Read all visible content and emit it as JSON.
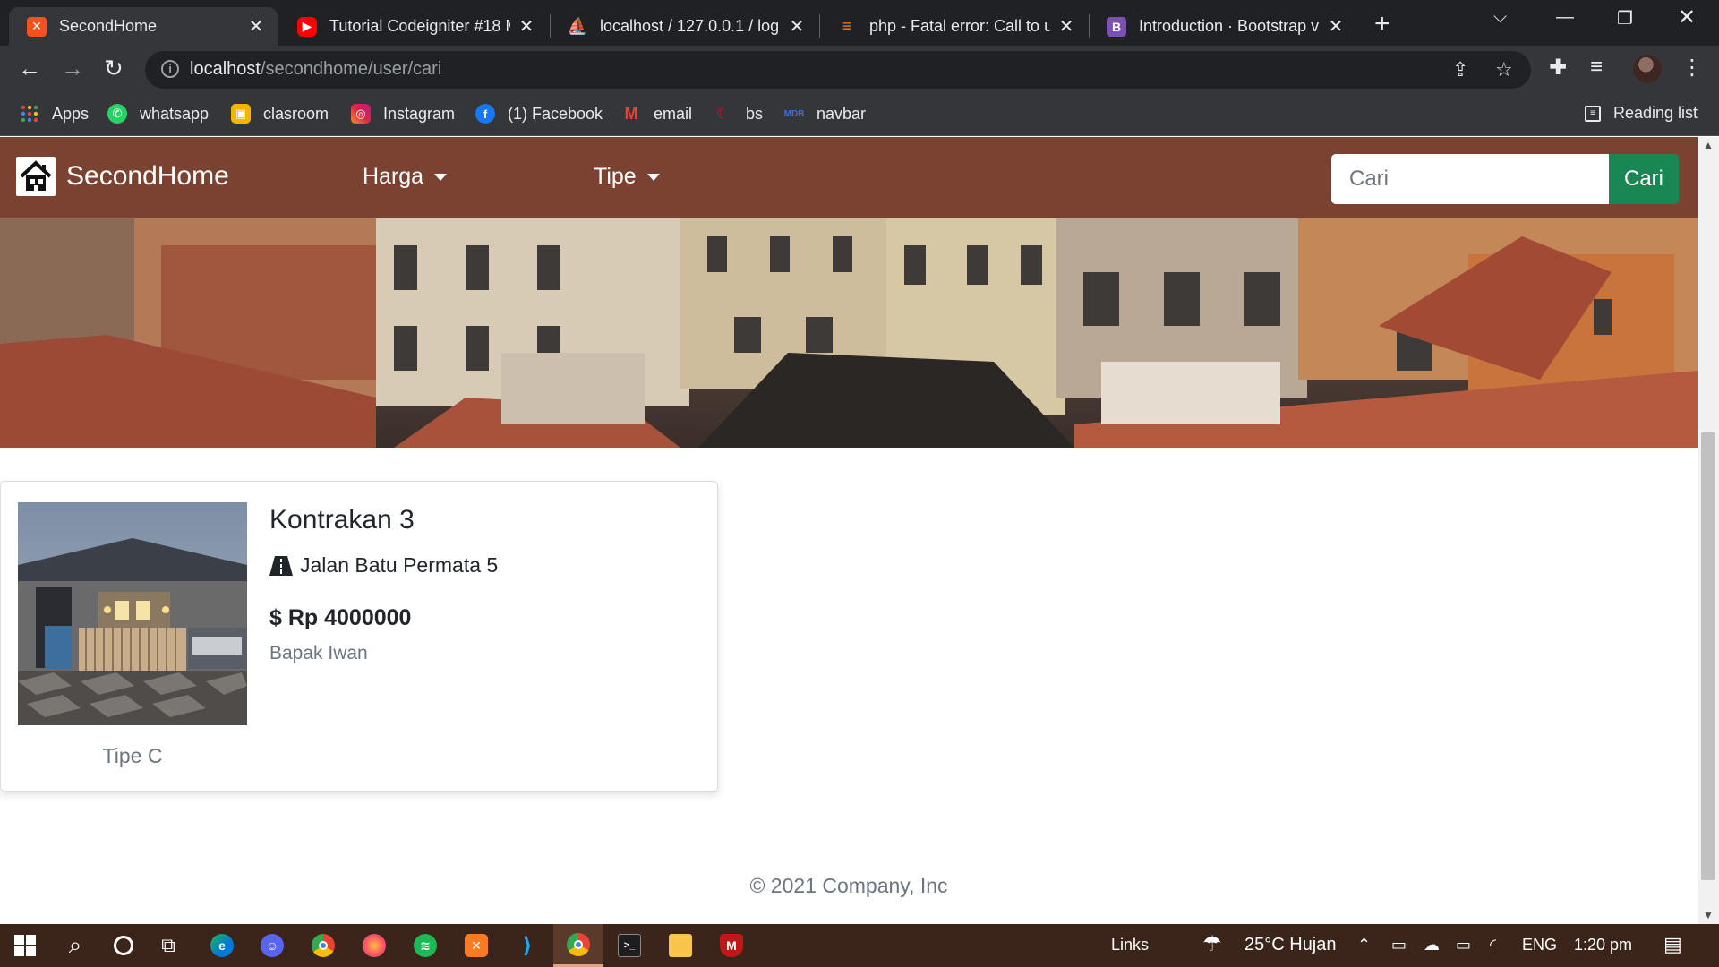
{
  "browser": {
    "tabs": [
      {
        "title": "SecondHome",
        "active": true
      },
      {
        "title": "Tutorial Codeigniter #18 M",
        "active": false
      },
      {
        "title": "localhost / 127.0.0.1 / log",
        "active": false
      },
      {
        "title": "php - Fatal error: Call to u",
        "active": false
      },
      {
        "title": "Introduction · Bootstrap v",
        "active": false
      }
    ],
    "url_host": "localhost",
    "url_path": "/secondhome/user/cari",
    "bookmarks": [
      {
        "label": "Apps",
        "icon": "apps-grid-icon",
        "color": "#ea4335"
      },
      {
        "label": "whatsapp",
        "icon": "whatsapp-icon",
        "color": "#25d366"
      },
      {
        "label": "clasroom",
        "icon": "classroom-icon",
        "color": "#f4b400"
      },
      {
        "label": "Instagram",
        "icon": "instagram-icon",
        "color": "#c13584"
      },
      {
        "label": "(1) Facebook",
        "icon": "facebook-icon",
        "color": "#1877f2"
      },
      {
        "label": "email",
        "icon": "gmail-icon",
        "color": "#ea4335"
      },
      {
        "label": "bs",
        "icon": "bs-icon",
        "color": "#b71c1c"
      },
      {
        "label": "navbar",
        "icon": "mdb-icon",
        "color": "#3b71ca"
      }
    ],
    "reading_list": "Reading list"
  },
  "site": {
    "brand": "SecondHome",
    "nav": {
      "harga": "Harga",
      "tipe": "Tipe"
    },
    "search": {
      "placeholder": "Cari",
      "button": "Cari"
    },
    "colors": {
      "navbar": "#7b4231",
      "search_button": "#198754"
    }
  },
  "listing": {
    "title": "Kontrakan 3",
    "address": "Jalan Batu Permata 5",
    "price": "$ Rp 4000000",
    "owner": "Bapak Iwan",
    "type": "Tipe C"
  },
  "footer": {
    "copyright": "© 2021 Company, Inc"
  },
  "taskbar": {
    "links_label": "Links",
    "weather": "25°C  Hujan",
    "language": "ENG",
    "time": "1:20 pm"
  }
}
